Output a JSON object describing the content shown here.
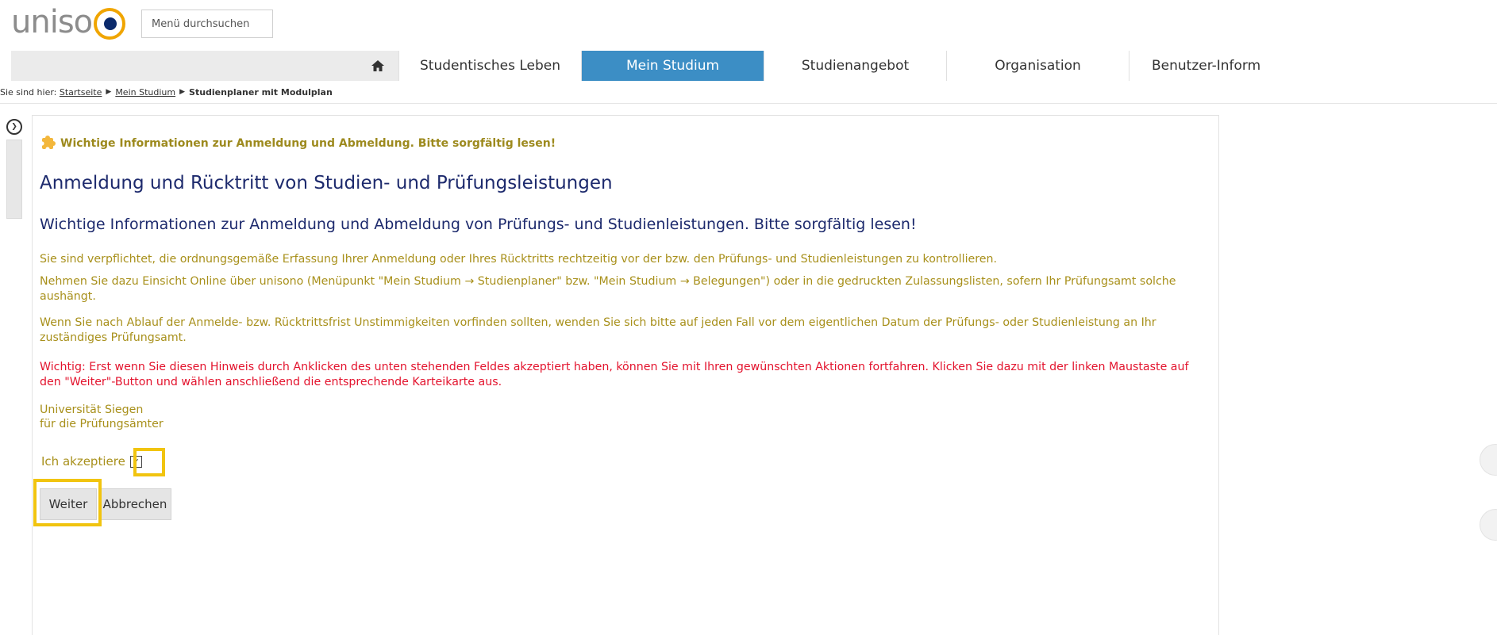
{
  "header": {
    "logo_text": "uniso",
    "menu_search_label": "Menü durchsuchen"
  },
  "nav": {
    "tabs": [
      {
        "label": "Studentisches Leben",
        "active": false
      },
      {
        "label": "Mein Studium",
        "active": true
      },
      {
        "label": "Studienangebot",
        "active": false
      },
      {
        "label": "Organisation",
        "active": false
      },
      {
        "label": "Benutzer-Inform",
        "active": false
      }
    ]
  },
  "breadcrumb": {
    "prefix": "Sie sind hier:",
    "items": [
      "Startseite",
      "Mein Studium"
    ],
    "current": "Studienplaner mit Modulplan"
  },
  "content": {
    "info_line": "Wichtige Informationen zur Anmeldung und Abmeldung. Bitte sorgfältig lesen!",
    "title": "Anmeldung und Rücktritt von Studien- und Prüfungsleistungen",
    "subtitle": "Wichtige Informationen zur Anmeldung und Abmeldung von Prüfungs- und Studienleistungen. Bitte sorgfältig lesen!",
    "paragraphs": [
      "Sie sind verpflichtet, die ordnungsgemäße Erfassung Ihrer Anmeldung oder Ihres Rücktritts rechtzeitig vor der bzw. den Prüfungs- und Studienleistungen zu kontrollieren.",
      "Nehmen Sie dazu Einsicht Online über unisono (Menüpunkt \"Mein Studium → Studienplaner\" bzw. \"Mein Studium → Belegungen\") oder in die gedruckten Zulassungslisten, sofern Ihr Prüfungsamt solche aushängt.",
      "Wenn Sie nach Ablauf der Anmelde- bzw. Rücktrittsfrist Unstimmigkeiten vorfinden sollten, wenden Sie sich bitte auf jeden Fall vor dem eigentlichen Datum der Prüfungs- oder Studienleistung an Ihr zuständiges Prüfungsamt."
    ],
    "warning": "Wichtig: Erst wenn Sie diesen Hinweis durch Anklicken des unten stehenden Feldes akzeptiert haben, können Sie mit Ihren gewünschten Aktionen fortfahren. Klicken Sie dazu mit der linken Maustaste auf den \"Weiter\"-Button und wählen anschließend die entsprechende Karteikarte aus.",
    "signature_line1": "Universität Siegen",
    "signature_line2": "für die Prüfungsämter",
    "accept_label": "Ich akzeptiere",
    "accept_checked": true,
    "button_next": "Weiter",
    "button_cancel": "Abbrechen"
  },
  "colors": {
    "brand_orange": "#f0a500",
    "brand_navy": "#0b2a6b",
    "nav_active": "#3c8ec5",
    "text_olive": "#a8901b",
    "text_red": "#e3132d",
    "heading_navy": "#1d2a6d",
    "highlight": "#f1c40f"
  }
}
